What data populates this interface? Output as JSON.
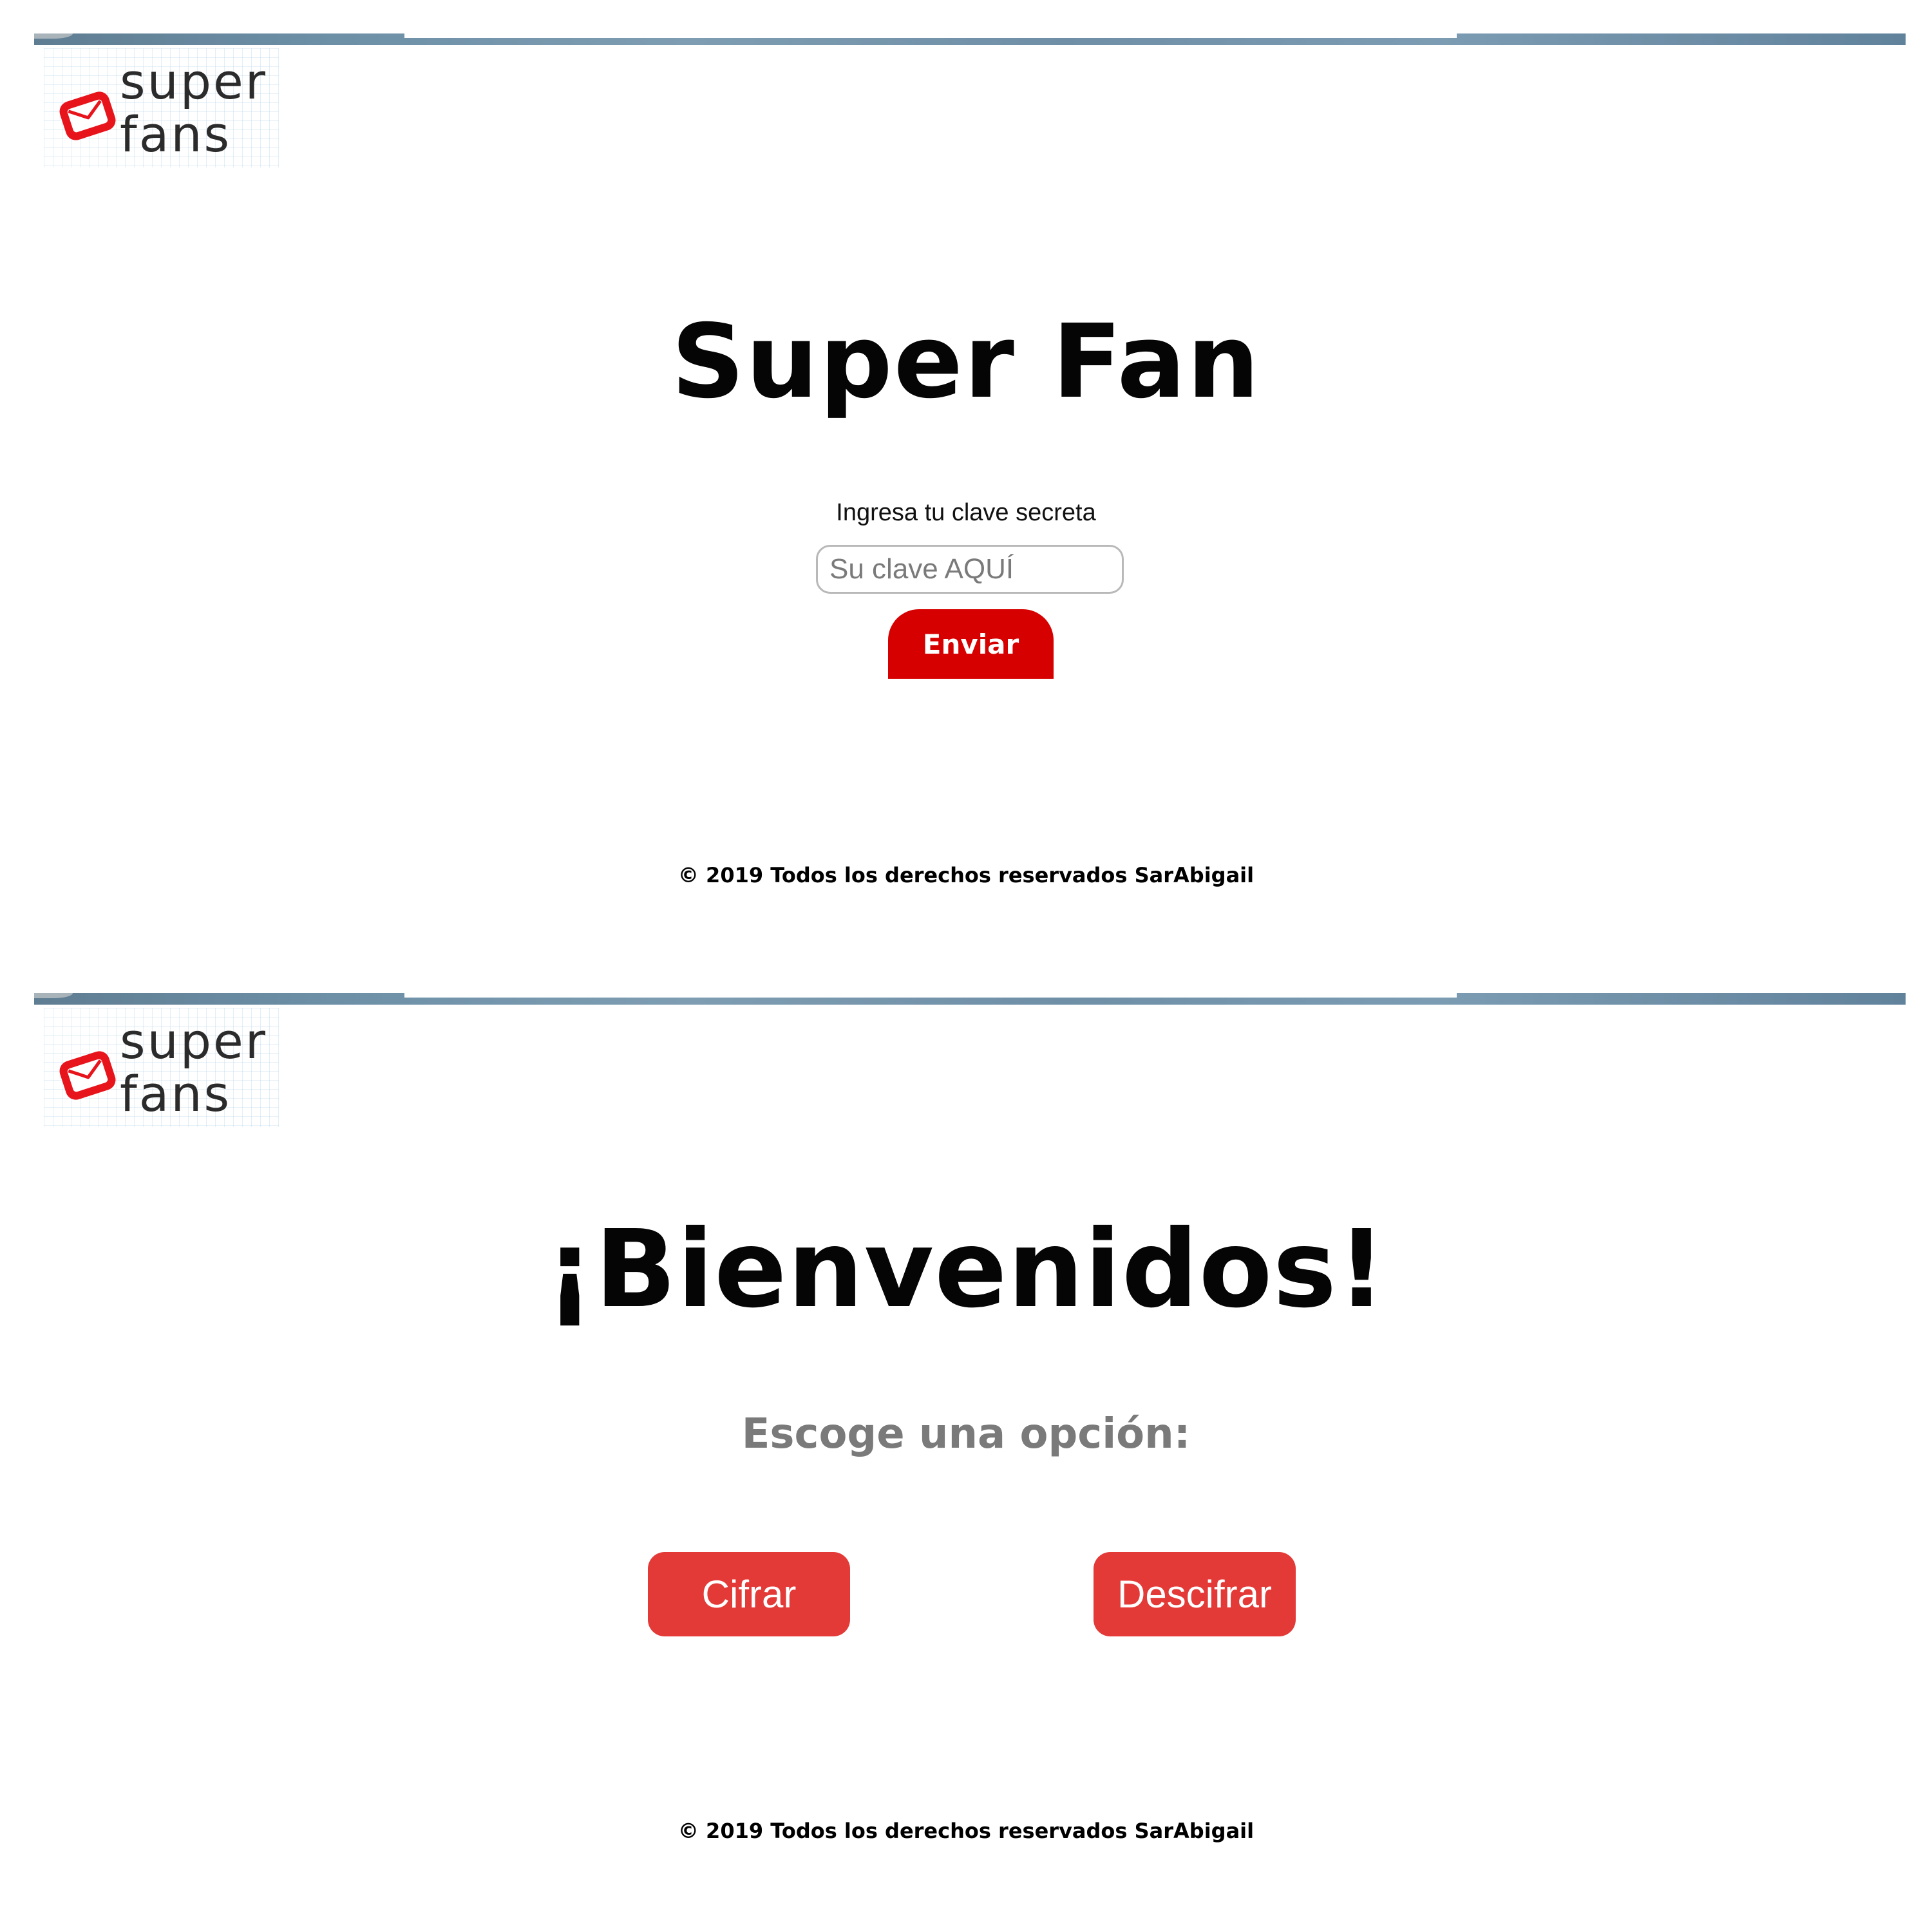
{
  "login_screen": {
    "logo": {
      "line1": "super",
      "line2": "fans",
      "icon": "envelope-icon"
    },
    "title": "Super Fan",
    "field_label": "Ingresa tu clave secreta",
    "input_placeholder": "Su clave AQUÍ",
    "input_value": "",
    "submit_label": "Enviar",
    "footer": "© 2019 Todos los derechos reservados SarAbigail"
  },
  "welcome_screen": {
    "logo": {
      "line1": "super",
      "line2": "fans",
      "icon": "envelope-icon"
    },
    "title": "¡Bienvenidos!",
    "subtitle": "Escoge una opción:",
    "options": [
      {
        "label": "Cifrar"
      },
      {
        "label": "Descifrar"
      }
    ],
    "footer": "© 2019 Todos los derechos reservados SarAbigail"
  },
  "colors": {
    "submit_button": "#d60000",
    "option_buttons": "#e33a38",
    "logo_icon": "#e8141c",
    "subtitle_gray": "#7a7a7a",
    "header_bar": "#6c8fa6"
  }
}
